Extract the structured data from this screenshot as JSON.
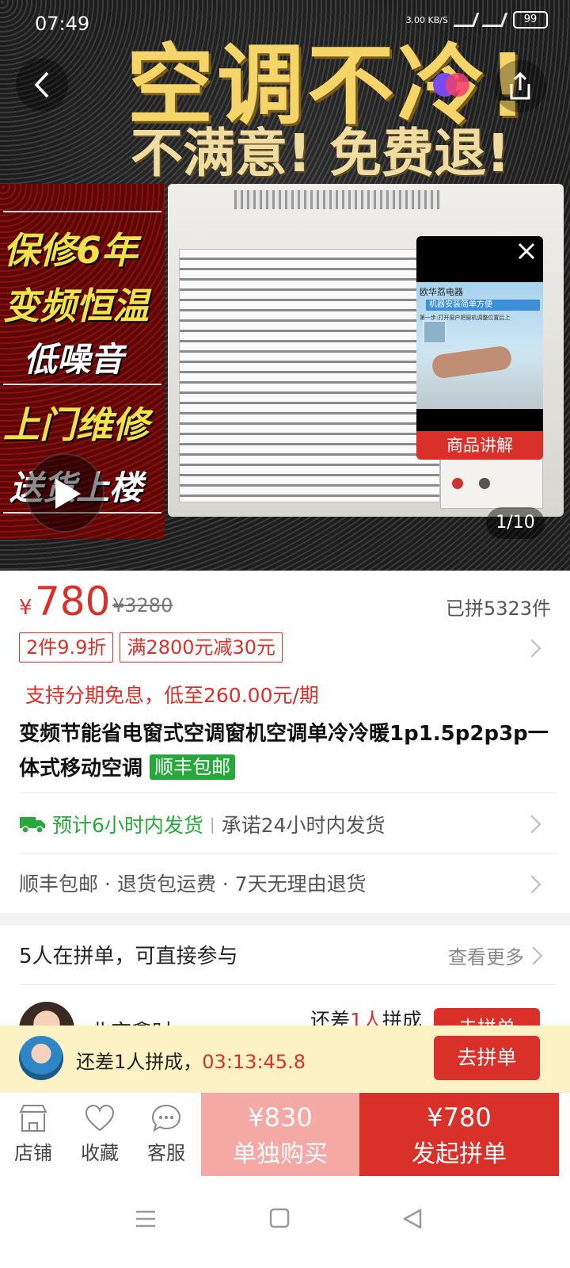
{
  "status": {
    "time": "07:49",
    "net_speed": "3.00 KB/S",
    "battery": "99"
  },
  "hero": {
    "headline1": "空调不冷!",
    "headline2": "不满意! 免费退!",
    "side_texts": [
      "保修6年",
      "变频恒温",
      "低噪音",
      "上门维修",
      "送货上楼"
    ],
    "mini_video": {
      "brand": "欧华荔电器",
      "banner": "机器安装简单方便",
      "small": "第一步:打开窗户把窗机调整位置后上",
      "caption": "商品讲解"
    },
    "counter": "1/10"
  },
  "price": {
    "currency": "¥",
    "current": "780",
    "original": "¥3280",
    "sold": "已拼5323件"
  },
  "tags": [
    "2件9.9折",
    "满2800元减30元"
  ],
  "installment": "支持分期免息，低至260.00元/期",
  "title": {
    "text": "变频节能省电窗式空调窗机空调单冷冷暖1p1.5p2p3p一体式移动空调",
    "badge": "顺丰包邮"
  },
  "shipping": {
    "estimate": "预计6小时内发货",
    "promise": "承诺24小时内发货"
  },
  "services": "顺丰包邮 · 退货包运费 · 7天无理由退货",
  "group": {
    "heading": "5人在拼单，可直接参与",
    "more": "查看更多"
  },
  "peek_row": {
    "name": "北京鑫时",
    "lack_prefix": "还差",
    "lack_num": "1人",
    "lack_suffix": "拼成",
    "join": "去拼单"
  },
  "banner": {
    "text": "还差1人拼成，",
    "countdown": "03:13:45.8",
    "button": "去拼单"
  },
  "bottom": {
    "store": "店铺",
    "favorite": "收藏",
    "service": "客服",
    "alone_price": "¥830",
    "alone_label": "单独购买",
    "group_price": "¥780",
    "group_label": "发起拼单"
  },
  "colors": {
    "accent": "#d9302a",
    "green": "#27a83a",
    "banner_bg": "#fdf2c4"
  }
}
